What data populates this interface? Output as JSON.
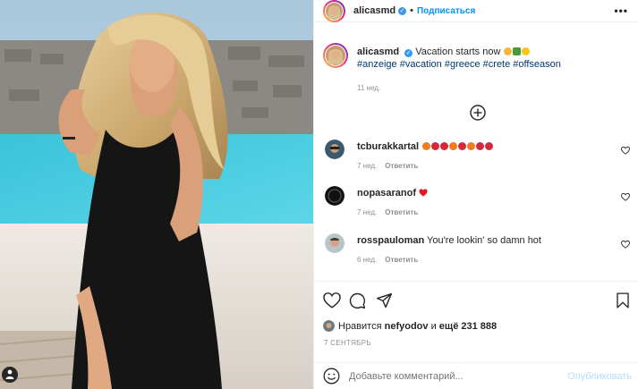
{
  "header": {
    "username": "alicasmd",
    "verified_mark": "✓",
    "separator": "•",
    "follow_label": "Подписаться",
    "more_label": "•••"
  },
  "caption": {
    "username": "alicasmd",
    "text": "Vacation starts now",
    "emoji_icons": [
      "smiling-face-with-heart-eyes-icon",
      "palm-tree-icon",
      "sun-icon"
    ],
    "hashtags": "#anzeige #vacation #greece #crete #offseason",
    "time": "11 нед."
  },
  "load_more_icon": "plus-circle-icon",
  "comments": [
    {
      "username": "tcburakkartal",
      "text": "",
      "emoji_icons": [
        "fire-icon",
        "rose-icon",
        "rose-icon",
        "fire-icon",
        "rose-icon",
        "fire-icon",
        "rose-icon",
        "rose-icon"
      ],
      "time": "7 нед.",
      "reply_label": "Ответить"
    },
    {
      "username": "nopasaranof",
      "text": "",
      "emoji_icons": [
        "red-heart-icon"
      ],
      "time": "7 нед.",
      "reply_label": "Ответить"
    },
    {
      "username": "rosspauloman",
      "text": "You're lookin' so damn hot",
      "emoji_icons": [],
      "time": "6 нед.",
      "reply_label": "Ответить"
    }
  ],
  "actions": {
    "icons": [
      "heart-icon",
      "comment-icon",
      "share-icon",
      "bookmark-icon"
    ],
    "likes_prefix": "Нравится",
    "liked_by": "nefyodov",
    "likes_and": "и",
    "likes_count": "ещё 231 888",
    "date": "7 СЕНТЯБРЬ"
  },
  "add_comment": {
    "placeholder": "Добавьте комментарий...",
    "publish_label": "Опубликовать"
  },
  "colors": {
    "accent": "#0095f6",
    "verified": "#3897f0",
    "hashtag": "#00376b",
    "muted": "#8e8e8e",
    "publish_disabled": "#b2dffc"
  }
}
